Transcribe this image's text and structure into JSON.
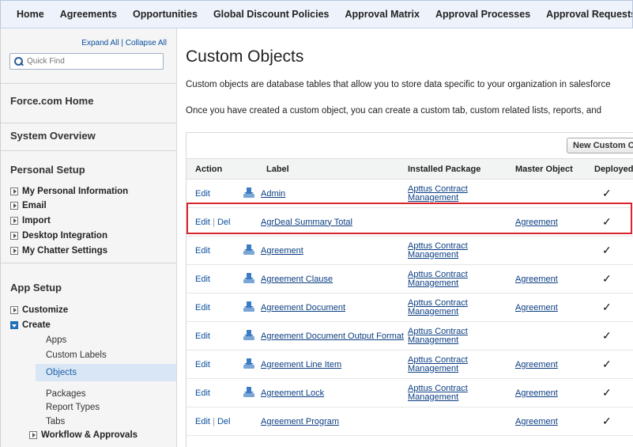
{
  "topnav": {
    "tabs": [
      "Home",
      "Agreements",
      "Opportunities",
      "Global Discount Policies",
      "Approval Matrix",
      "Approval Processes",
      "Approval Requests"
    ]
  },
  "sidebar": {
    "expand_all": "Expand All",
    "separator": "|",
    "collapse_all": "Collapse All",
    "quick_find_placeholder": "Quick Find",
    "force_home": "Force.com Home",
    "system_overview": "System Overview",
    "personal_setup": {
      "title": "Personal Setup",
      "items": [
        "My Personal Information",
        "Email",
        "Import",
        "Desktop Integration",
        "My Chatter Settings"
      ]
    },
    "app_setup": {
      "title": "App Setup",
      "customize": "Customize",
      "create": "Create",
      "create_children": [
        "Apps",
        "Custom Labels",
        "Objects",
        "Packages",
        "Report Types",
        "Tabs"
      ],
      "selected": "Objects",
      "workflow": "Workflow & Approvals"
    }
  },
  "main": {
    "title": "Custom Objects",
    "desc1": "Custom objects are database tables that allow you to store data specific to your organization in salesforce",
    "desc2": "Once you have created a custom object, you can create a custom tab, custom related lists, reports, and",
    "new_button": "New Custom Object",
    "columns": [
      "Action",
      "Label",
      "Installed Package",
      "Master Object",
      "Deployed"
    ],
    "rows": [
      {
        "edit": "Edit",
        "del": "",
        "icon": true,
        "label": "Admin",
        "pkg1": "Apttus Contract",
        "pkg2": "Management",
        "master": "",
        "deployed": "✓"
      },
      {
        "edit": "Edit",
        "del": "Del",
        "icon": false,
        "label": "AgrDeal Summary Total",
        "pkg1": "",
        "pkg2": "",
        "master": "Agreement",
        "deployed": "✓"
      },
      {
        "edit": "Edit",
        "del": "",
        "icon": true,
        "label": "Agreement",
        "pkg1": "Apttus Contract",
        "pkg2": "Management",
        "master": "",
        "deployed": "✓"
      },
      {
        "edit": "Edit",
        "del": "",
        "icon": true,
        "label": "Agreement Clause",
        "pkg1": "Apttus Contract",
        "pkg2": "Management",
        "master": "Agreement",
        "deployed": "✓"
      },
      {
        "edit": "Edit",
        "del": "",
        "icon": true,
        "label": "Agreement Document",
        "pkg1": "Apttus Contract",
        "pkg2": "Management",
        "master": "Agreement",
        "deployed": "✓"
      },
      {
        "edit": "Edit",
        "del": "",
        "icon": true,
        "label": "Agreement Document Output Format",
        "pkg1": "Apttus Contract",
        "pkg2": "Management",
        "master": "",
        "deployed": "✓"
      },
      {
        "edit": "Edit",
        "del": "",
        "icon": true,
        "label": "Agreement Line Item",
        "pkg1": "Apttus Contract",
        "pkg2": "Management",
        "master": "Agreement",
        "deployed": "✓"
      },
      {
        "edit": "Edit",
        "del": "",
        "icon": true,
        "label": "Agreement Lock",
        "pkg1": "Apttus Contract",
        "pkg2": "Management",
        "master": "Agreement",
        "deployed": "✓"
      },
      {
        "edit": "Edit",
        "del": "Del",
        "icon": false,
        "label": "Agreement Program",
        "pkg1": "",
        "pkg2": "",
        "master": "Agreement",
        "deployed": "✓"
      }
    ]
  }
}
